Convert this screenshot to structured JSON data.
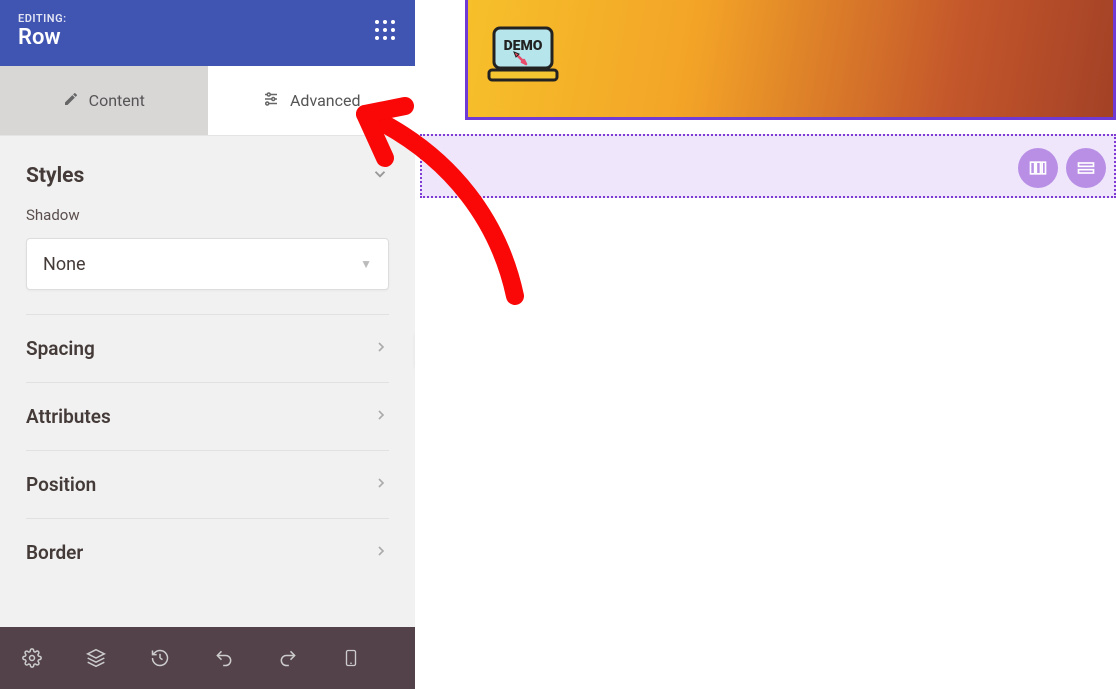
{
  "header": {
    "editing_label": "EDITING:",
    "title": "Row"
  },
  "tabs": {
    "content": "Content",
    "advanced": "Advanced"
  },
  "styles": {
    "heading": "Styles",
    "shadow_label": "Shadow",
    "shadow_value": "None"
  },
  "accordion": [
    "Spacing",
    "Attributes",
    "Position",
    "Border"
  ],
  "canvas": {
    "demo_label": "DEMO"
  }
}
